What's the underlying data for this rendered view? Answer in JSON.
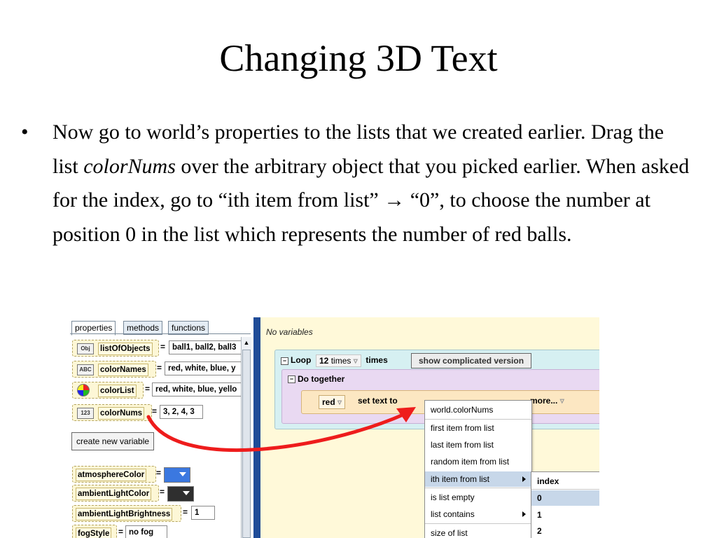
{
  "slide": {
    "title": "Changing 3D Text",
    "bullet_marker": "•",
    "bullet": {
      "part1": "Now go to world’s properties to the lists that we created earlier. Drag the list ",
      "italic": "colorNums",
      "part2": " over the arbitrary object that you picked earlier. When asked for the index, go to “ith item from list” ",
      "arrow": "→",
      "part3": " “0”, to choose the number at position 0 in the list which represents the number of red balls."
    }
  },
  "left_panel": {
    "tabs": [
      "properties",
      "methods",
      "functions"
    ],
    "variables": [
      {
        "icon": "Obj",
        "name": "listOfObjects",
        "value": "ball1, ball2, ball3"
      },
      {
        "icon": "ABC",
        "name": "colorNames",
        "value": "red, white, blue, y"
      },
      {
        "icon": "",
        "name": "colorList",
        "value": "red, white, blue, yello"
      },
      {
        "icon": "123",
        "name": "colorNums",
        "value": "3, 2, 4, 3"
      }
    ],
    "create_new_variable": "create new variable",
    "properties": [
      {
        "name": "atmosphereColor",
        "color": "#3b78e0"
      },
      {
        "name": "ambientLightColor",
        "color": "#2f2f2f"
      },
      {
        "name": "ambientLightBrightness",
        "value": "1"
      },
      {
        "name": "fogStyle",
        "value": "no fog"
      }
    ],
    "equals": "="
  },
  "editor": {
    "no_variables": "No variables",
    "loop": {
      "label": "Loop",
      "count": "12",
      "unit": "times",
      "times": "times"
    },
    "show_complicated": "show complicated version",
    "do_together": "Do together",
    "stmt": {
      "object": "red",
      "set_text": "set text to",
      "more": "more..."
    }
  },
  "context_menu": {
    "items": [
      "world.colorNums",
      "first item from list",
      "last item from list",
      "random item from list",
      "ith item from list",
      "is list empty",
      "list contains",
      "size of list"
    ],
    "selected": "ith item from list"
  },
  "submenu": {
    "items": [
      "index",
      "0",
      "1",
      "2"
    ],
    "selected": "0"
  }
}
